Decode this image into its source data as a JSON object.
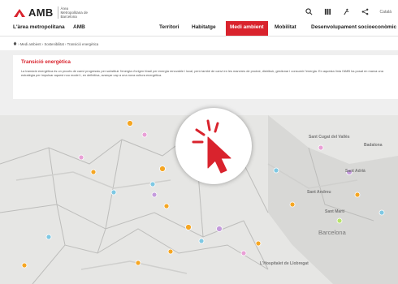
{
  "header": {
    "logo_text": "AMB",
    "logo_subtitle": "Àrea Metropolitana de Barcelona",
    "language": "Català",
    "icons": [
      "search-icon",
      "grid-icon",
      "accessibility-icon",
      "share-icon"
    ]
  },
  "nav": {
    "items": [
      "L'àrea metropolitana",
      "AMB",
      "Territori",
      "Habitatge",
      "Medi ambient",
      "Mobilitat",
      "Desenvolupament socioeconòmic"
    ],
    "active": "Medi ambient"
  },
  "breadcrumb": {
    "home_icon": "home-icon",
    "items": [
      "Medi ambient",
      "Sostenibilitat",
      "Transició energètica"
    ]
  },
  "section": {
    "title": "Transició energètica",
    "description": "La transició energètica és un procés de canvi progressiu per substituir l'energia d'origen fòssil per energia renovable i local, però també de canvi en les maneres de produir, distribuir, gestionar i consumir l'energia. En aquesta línia l'AMB ha posat en marxa una estratègia per impulsar aquest nou model i, en definitiva, avançar cap a una nova cultura energètica."
  },
  "map": {
    "labels": [
      "Sant Cugat del Vallès",
      "Badalona",
      "Sant Adrià",
      "Barcelona",
      "L'Hospitalet de Llobregat",
      "Sant Andreu",
      "Sant Martí"
    ],
    "city_label": "Barcelona"
  },
  "overlay": {
    "icon": "click-cursor-icon",
    "accent_color": "#d9232d"
  },
  "colors": {
    "brand": "#d9232d"
  }
}
